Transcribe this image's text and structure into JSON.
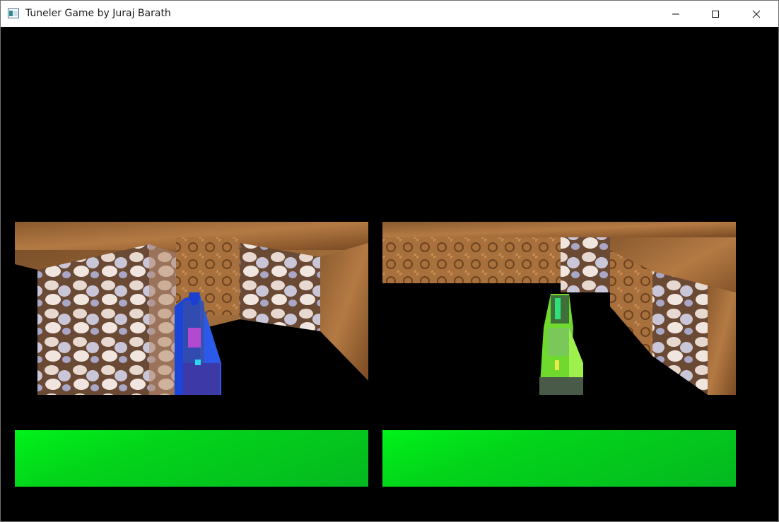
{
  "window": {
    "title": "Tuneler Game by Juraj Barath",
    "icon": "app-window-icon",
    "controls": [
      "minimize-icon",
      "maximize-icon",
      "close-icon"
    ]
  },
  "players": [
    {
      "id": "player-1",
      "tank_color": "#1a48e0",
      "health": 1.0
    },
    {
      "id": "player-2",
      "tank_color": "#7ee03a",
      "health": 1.0
    }
  ],
  "colors": {
    "background": "#000000",
    "health_bar": "#04c81c",
    "titlebar": "#ffffff"
  }
}
